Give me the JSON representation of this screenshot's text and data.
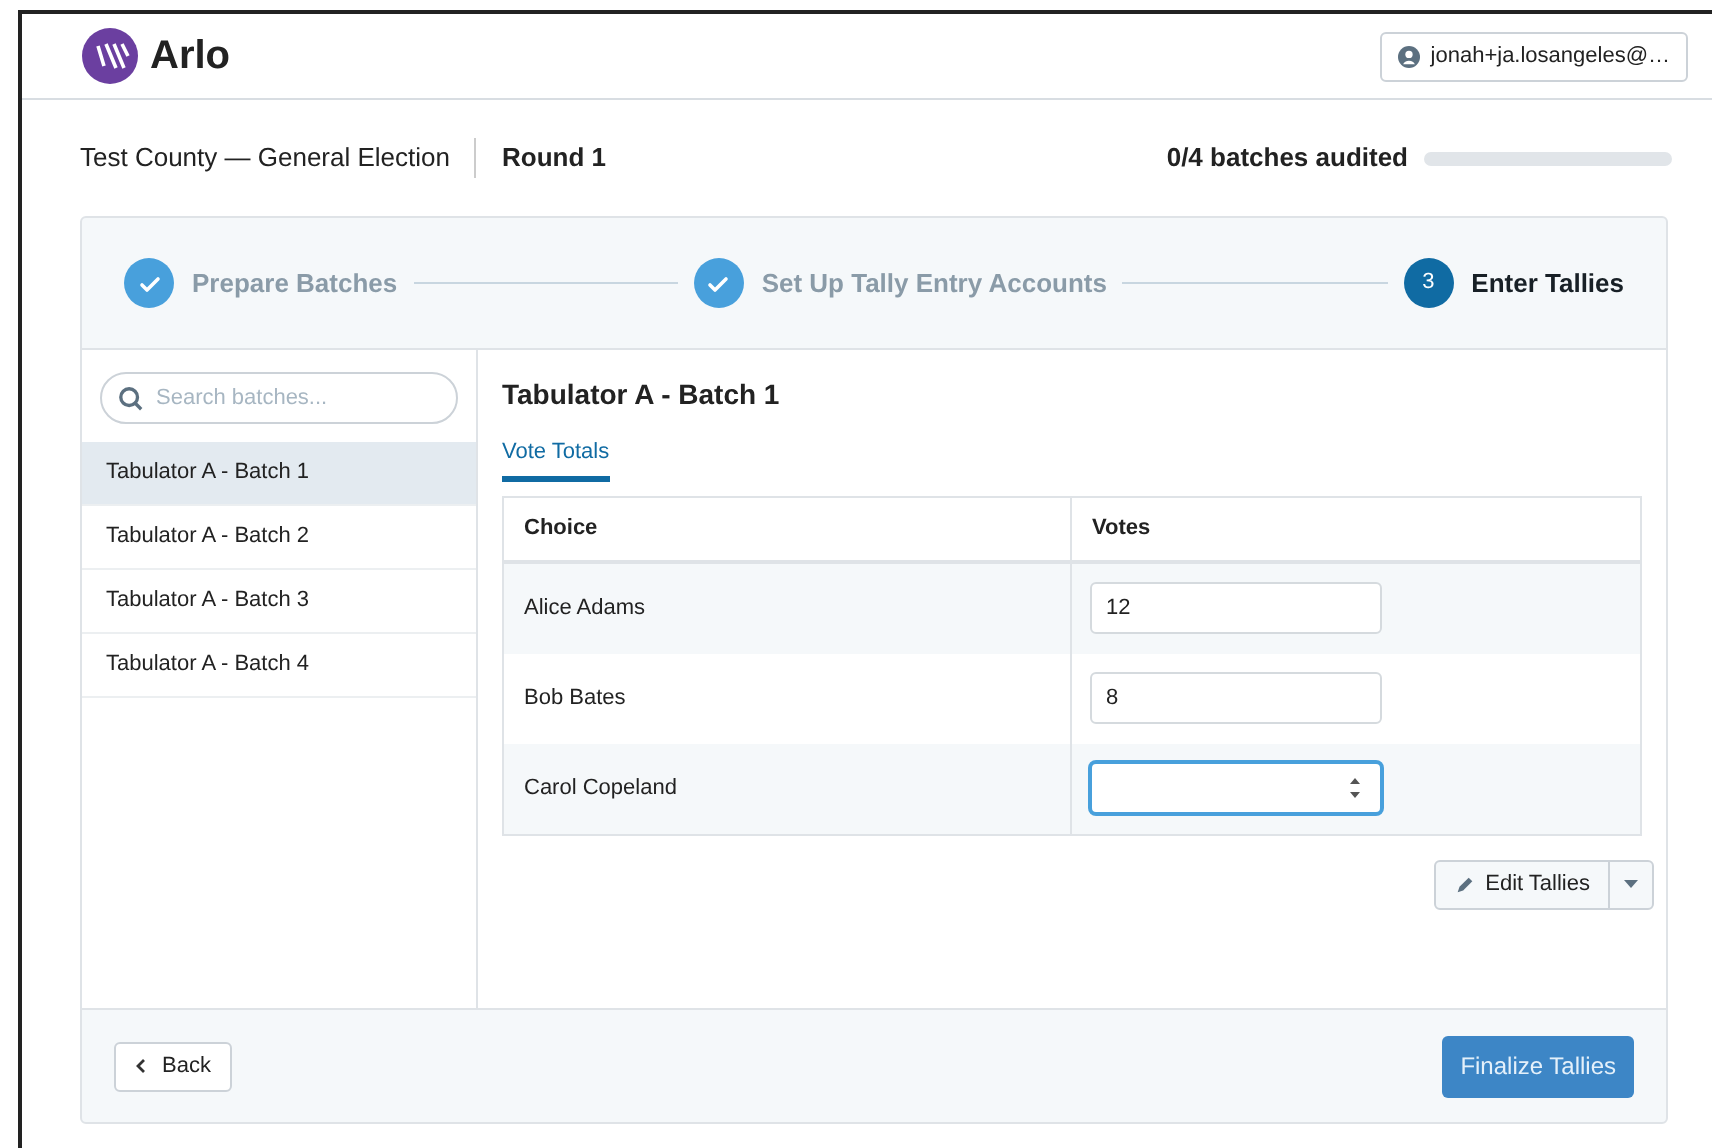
{
  "header": {
    "logo_text": "Arlo",
    "user": "jonah+ja.losangeles@…"
  },
  "context": {
    "election": "Test County — General Election",
    "round": "Round 1",
    "progress_label": "0/4 batches audited"
  },
  "steps": [
    {
      "label": "Prepare Batches",
      "completed": true,
      "current": false
    },
    {
      "label": "Set Up Tally Entry Accounts",
      "completed": true,
      "current": false
    },
    {
      "number": "3",
      "label": "Enter Tallies",
      "completed": false,
      "current": true
    }
  ],
  "sidebar": {
    "search": {
      "placeholder": "Search batches..."
    },
    "items": [
      {
        "label": "Tabulator A - Batch 1",
        "selected": true
      },
      {
        "label": "Tabulator A - Batch 2",
        "selected": false
      },
      {
        "label": "Tabulator A - Batch 3",
        "selected": false
      },
      {
        "label": "Tabulator A - Batch 4",
        "selected": false
      }
    ]
  },
  "detail": {
    "title": "Tabulator A - Batch 1",
    "tabs": [
      {
        "label": "Vote Totals",
        "selected": true
      }
    ],
    "table": {
      "columns": [
        "Choice",
        "Votes"
      ],
      "rows": [
        {
          "choice": "Alice Adams",
          "votes": "12",
          "focused": false
        },
        {
          "choice": "Bob Bates",
          "votes": "8",
          "focused": false
        },
        {
          "choice": "Carol Copeland",
          "votes": "",
          "focused": true
        }
      ]
    },
    "edit_button": "Edit Tallies"
  },
  "footer": {
    "back": "Back",
    "finalize": "Finalize Tallies"
  }
}
